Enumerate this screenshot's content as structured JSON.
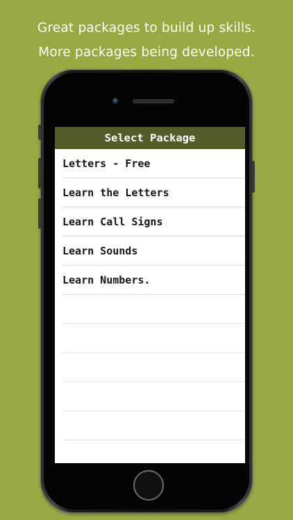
{
  "captions": {
    "line1": "Great packages to build up skills.",
    "line2": "More packages being developed."
  },
  "colors": {
    "background": "#98a843",
    "nav_bar": "#545d27",
    "screen": "#ffffff"
  },
  "screen": {
    "title": "Select Package",
    "packages": [
      {
        "label": "Letters - Free"
      },
      {
        "label": "Learn the Letters"
      },
      {
        "label": "Learn Call Signs"
      },
      {
        "label": "Learn Sounds"
      },
      {
        "label": "Learn Numbers."
      }
    ]
  }
}
